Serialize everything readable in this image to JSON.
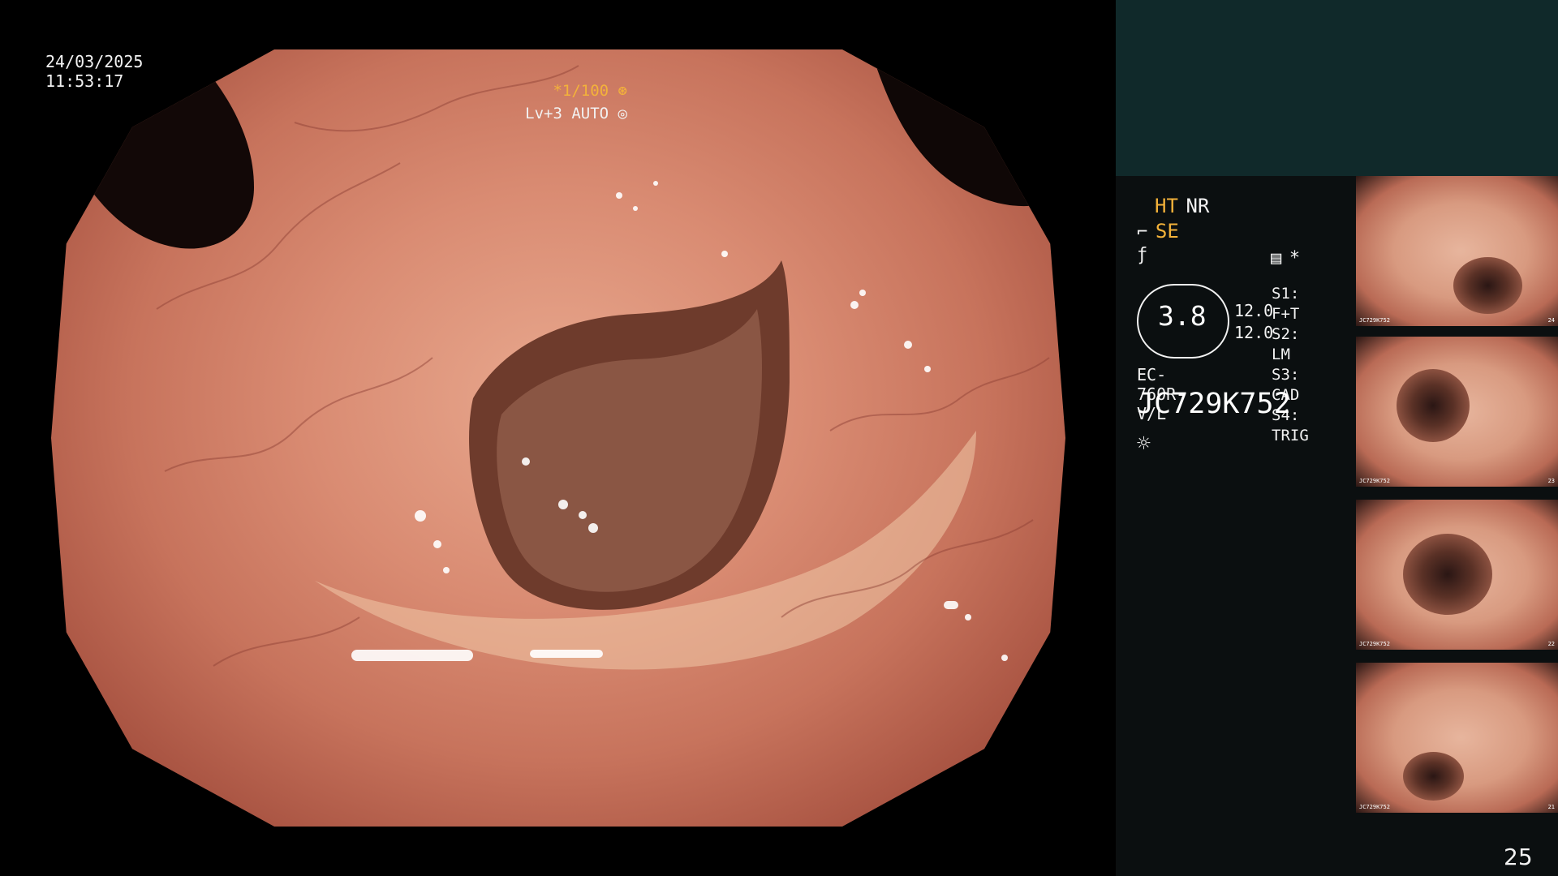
{
  "header": {
    "date": "24/03/2025",
    "time": "11:53:17",
    "zoom_label": "*1/100",
    "zoom_icon": "shutter-icon",
    "lv_label": "Lv+3 AUTO",
    "auto_icon": "iris-icon"
  },
  "panel": {
    "ht_label": "HT",
    "nr_label": "NR",
    "se_label": "SE",
    "se_icon": "scope-icon",
    "freeze_icon": "freeze-icon",
    "settings_icon": "list-icon",
    "asterisk": "*",
    "hex_value": "3.8",
    "hex_left_top": "12.0",
    "hex_left_bottom": "12.0",
    "scope_list": [
      {
        "key": "S1",
        "value": "F+T"
      },
      {
        "key": "S2",
        "value": "LM"
      },
      {
        "key": "S3",
        "value": "CAD"
      },
      {
        "key": "S4",
        "value": "TRIG"
      }
    ],
    "model": "EC-760R-V/L",
    "serial": "JC729K752",
    "light_icon": "sun-icon"
  },
  "thumbnails": [
    {
      "number": "24",
      "label": "JC729K752"
    },
    {
      "number": "23",
      "label": "JC729K752"
    },
    {
      "number": "22",
      "label": "JC729K752"
    },
    {
      "number": "21",
      "label": "JC729K752"
    }
  ],
  "page_number": "25",
  "colors": {
    "accent": "#f3b23a",
    "panel_top": "#10292a",
    "panel_bg": "#0b0f10",
    "text": "#f2f2f2"
  }
}
